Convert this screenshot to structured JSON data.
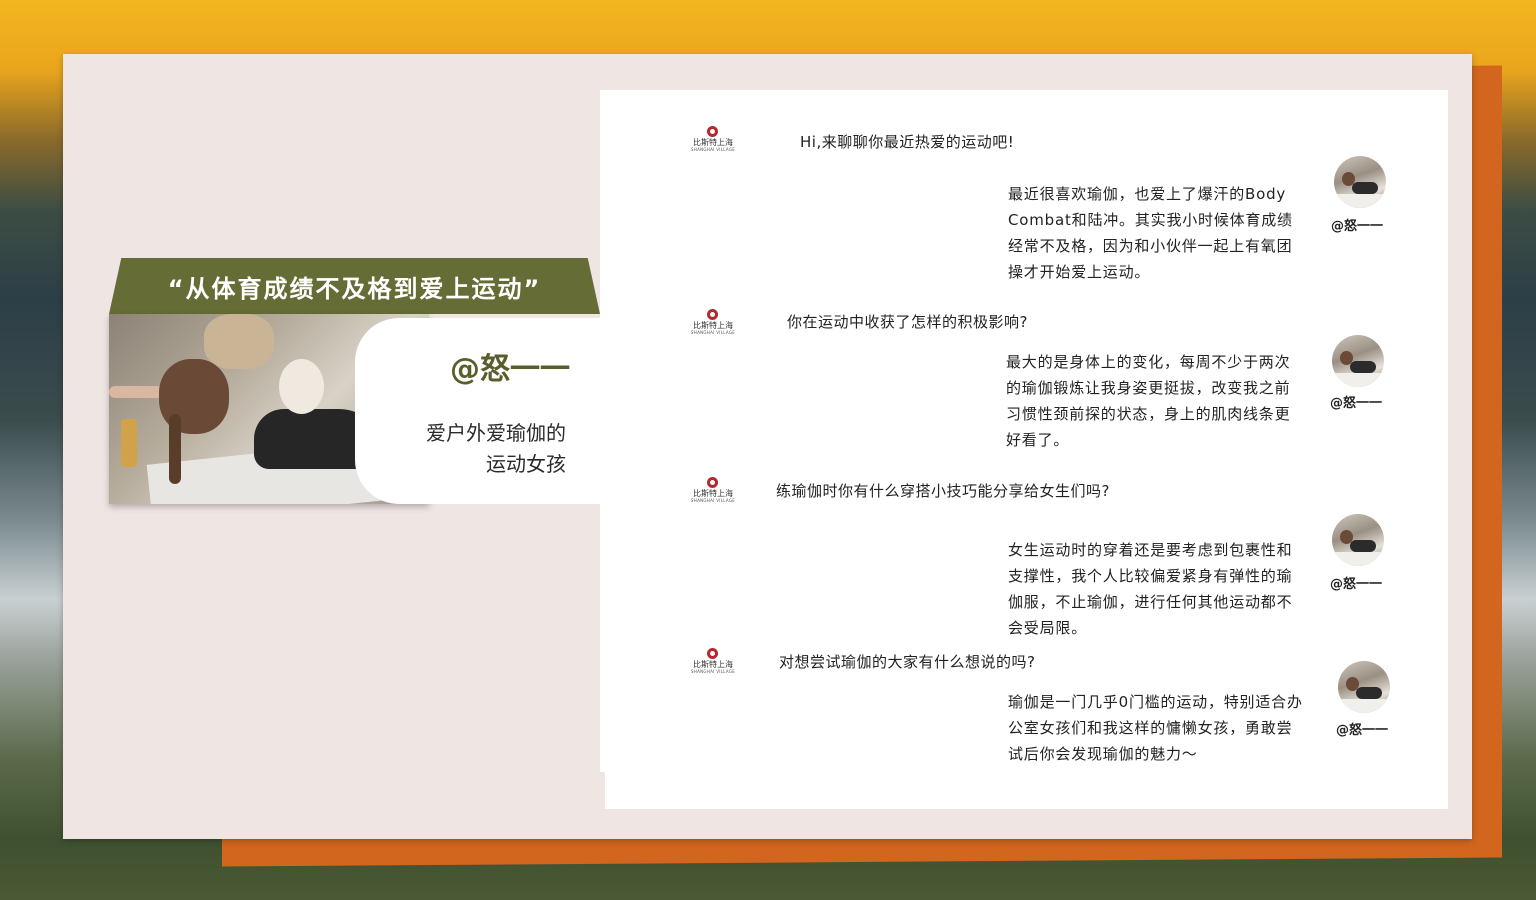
{
  "banner": {
    "quote": "“从体育成绩不及格到爱上运动”"
  },
  "profile": {
    "name": "@怒一一",
    "desc_line1": "爱户外爱瑜伽的",
    "desc_line2": "运动女孩",
    "photo": "woman-yoga-with-dog-photo"
  },
  "logo": {
    "cn": "比斯特上海",
    "en": "SHANGHAI VILLAGE"
  },
  "chat": [
    {
      "question": "Hi,来聊聊你最近热爱的运动吧!",
      "answer": [
        "最近很喜欢瑜伽，也爱上了爆汗的Body",
        "Combat和陆冲。其实我小时候体育成绩",
        "经常不及格，因为和小伙伴一起上有氧团",
        "操才开始爱上运动。"
      ],
      "handle": "@怒一一"
    },
    {
      "question": "你在运动中收获了怎样的积极影响?",
      "answer": [
        "最大的是身体上的变化，每周不少于两次",
        "的瑜伽锻炼让我身姿更挺拔，改变我之前",
        "习惯性颈前探的状态，身上的肌肉线条更",
        "好看了。"
      ],
      "handle": "@怒一一"
    },
    {
      "question": "练瑜伽时你有什么穿搭小技巧能分享给女生们吗?",
      "answer": [
        "女生运动时的穿着还是要考虑到包裹性和",
        "支撑性，我个人比较偏爱紧身有弹性的瑜",
        "伽服，不止瑜伽，进行任何其他运动都不",
        "会受局限。"
      ],
      "handle": "@怒一一"
    },
    {
      "question": "对想尝试瑜伽的大家有什么想说的吗?",
      "answer": [
        "瑜伽是一门几乎0门槛的运动，特别适合办",
        "公室女孩们和我这样的慵懒女孩，勇敢尝",
        "试后你会发现瑜伽的魅力～"
      ],
      "handle": "@怒一一"
    }
  ],
  "colors": {
    "accent_olive": "#656c35",
    "name_olive": "#5a5e2d",
    "orange": "#d2661f",
    "card": "#efe5e3",
    "logo_red": "#b5282e"
  }
}
